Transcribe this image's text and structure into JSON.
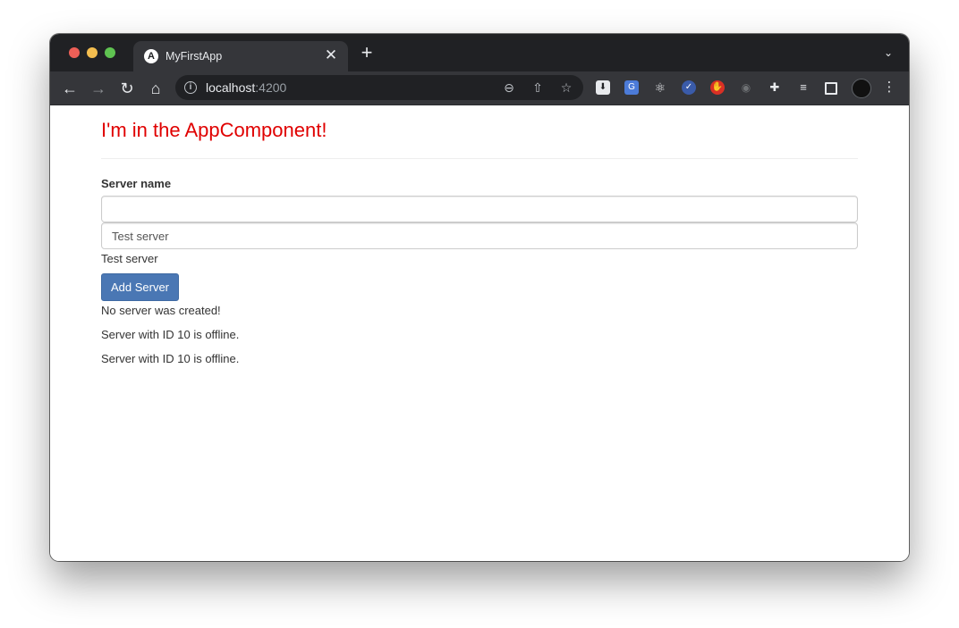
{
  "browser": {
    "tab": {
      "title": "MyFirstApp",
      "favicon": "A",
      "close": "✕"
    },
    "new_tab": "+",
    "tabs_menu": "⌄",
    "url": {
      "host": "localhost",
      "port": ":4200"
    },
    "ext_icons": [
      "zoom-out-icon",
      "share-icon",
      "star-icon",
      "extension-icons",
      "puzzle-icon",
      "reading-list-icon",
      "side-panel-icon",
      "avatar",
      "more-icon"
    ]
  },
  "page": {
    "heading": "I'm in the AppComponent!",
    "server_name_label": "Server name",
    "input1_value": "",
    "input2_value": "Test server",
    "echo_text": "Test server",
    "add_button": "Add Server",
    "status_message": "No server was created!",
    "servers": [
      "Server with ID 10 is offline.",
      "Server with ID 10 is offline."
    ]
  },
  "colors": {
    "heading": "#e00000",
    "button": "#4a77b4"
  }
}
